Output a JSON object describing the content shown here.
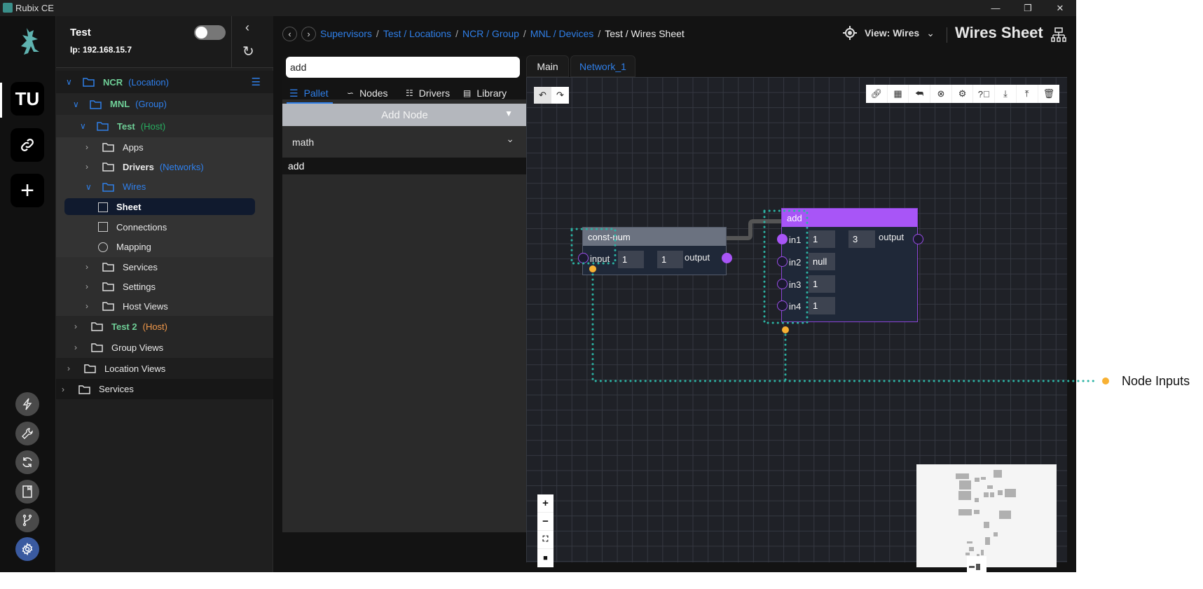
{
  "window": {
    "title": "Rubix CE",
    "controls": [
      "minimize",
      "maximize",
      "close"
    ]
  },
  "rail": {
    "top_items": [
      {
        "label": "TU"
      },
      {
        "icon": "link-icon"
      },
      {
        "icon": "plus-icon"
      }
    ],
    "bottom_items": [
      {
        "icon": "flash-icon"
      },
      {
        "icon": "wrench-icon"
      },
      {
        "icon": "sync-icon"
      },
      {
        "icon": "book-icon"
      },
      {
        "icon": "git-branch-icon"
      },
      {
        "icon": "gear-icon",
        "active": true
      }
    ],
    "active_color": "#3a5aa0"
  },
  "sidebar": {
    "host_name": "Test",
    "ip": "Ip: 192.168.15.7",
    "toggle_on": false,
    "tree": [
      {
        "label": "NCR",
        "sub": "(Location)",
        "level": 0,
        "open": true,
        "color": "#6fcf97",
        "sub_color": "#2f80ed"
      },
      {
        "label": "MNL",
        "sub": "(Group)",
        "level": 1,
        "open": true,
        "color": "#6fcf97",
        "sub_color": "#2f80ed"
      },
      {
        "label": "Test",
        "sub": "(Host)",
        "level": 2,
        "open": true,
        "color": "#6fcf97",
        "sub_color": "#27ae60"
      },
      {
        "label": "Apps",
        "level": 3
      },
      {
        "label": "Drivers",
        "sub": "(Networks)",
        "level": 3,
        "sub_color": "#2f80ed"
      },
      {
        "label": "Wires",
        "level": 3,
        "open": true,
        "color": "#2f80ed"
      },
      {
        "label": "Sheet",
        "level": 4,
        "active": true,
        "icon": "sheet-icon"
      },
      {
        "label": "Connections",
        "level": 4,
        "icon": "sitemap-icon"
      },
      {
        "label": "Mapping",
        "level": 4,
        "icon": "mapping-icon"
      },
      {
        "label": "Services",
        "level": 3
      },
      {
        "label": "Settings",
        "level": 3
      },
      {
        "label": "Host Views",
        "level": 3
      },
      {
        "label": "Test 2",
        "sub": "(Host)",
        "level": 2,
        "color": "#6fcf97",
        "sub_color": "#f2994a"
      },
      {
        "label": "Group Views",
        "level": 2
      },
      {
        "label": "Location Views",
        "level": 1
      },
      {
        "label": "Services",
        "level": 0
      }
    ]
  },
  "breadcrumb": [
    "Supervisors",
    "Test / Locations",
    "NCR / Group",
    "MNL / Devices",
    "Test / Wires Sheet"
  ],
  "header": {
    "view_label": "View: Wires",
    "title": "Wires Sheet"
  },
  "palette": {
    "search_value": "add",
    "tabs": [
      {
        "label": "Pallet",
        "active": true
      },
      {
        "label": "Nodes"
      },
      {
        "label": "Drivers"
      },
      {
        "label": "Library"
      }
    ],
    "add_node_label": "Add Node",
    "category": "math",
    "results": [
      "add"
    ]
  },
  "sheet_tabs": [
    {
      "label": "Main",
      "active": true
    },
    {
      "label": "Network_1"
    }
  ],
  "toolbar": [
    "link-icon",
    "group-icon",
    "undo-arrow-icon",
    "close-circle-icon",
    "gear-icon",
    "help-icon",
    "download-icon",
    "upload-icon",
    "trash-icon"
  ],
  "history": [
    "undo-icon",
    "redo-icon"
  ],
  "zoom_controls": [
    "zoom-in-icon",
    "zoom-out-icon",
    "fit-view-icon",
    "lock-icon"
  ],
  "nodes": [
    {
      "title": "const-num",
      "header_color": "#6b7280",
      "inputs": [
        {
          "name": "input",
          "value": "1"
        }
      ],
      "output_value": "1",
      "output": "output"
    },
    {
      "title": "add",
      "header_color": "#a855f7",
      "inputs": [
        {
          "name": "in1",
          "value": "1"
        },
        {
          "name": "in2",
          "value": "null"
        },
        {
          "name": "in3",
          "value": "1"
        },
        {
          "name": "in4",
          "value": "1"
        }
      ],
      "output_value": "3",
      "output": "output"
    }
  ],
  "annotation": {
    "label": "Node Inputs",
    "dot_color": "#f8b133",
    "line_color": "#2bb3a3"
  }
}
